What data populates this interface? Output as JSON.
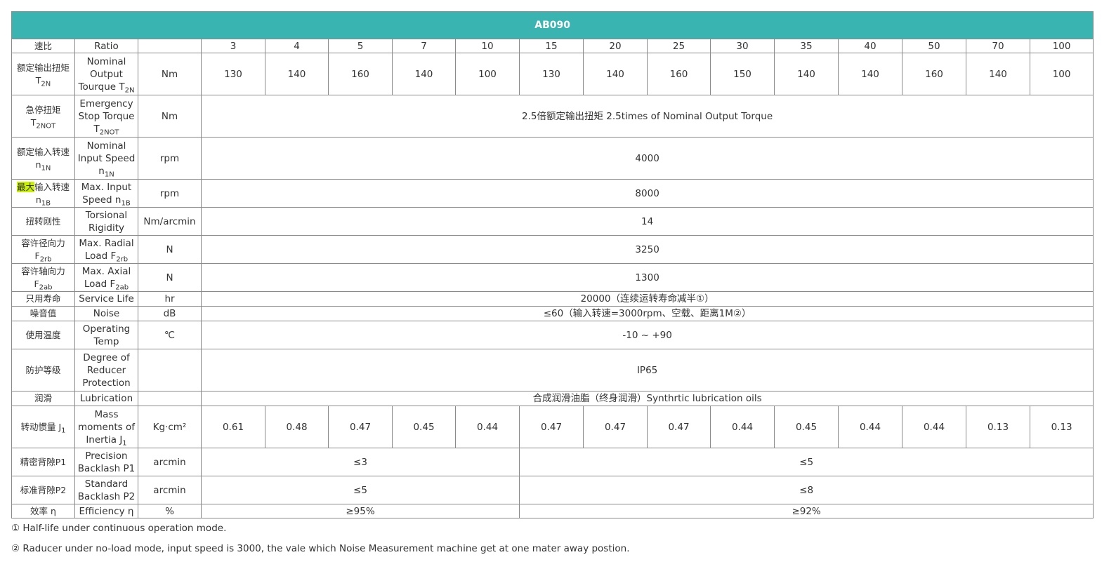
{
  "title": "AB090",
  "ratio_row": {
    "cn": "速比",
    "en": "Ratio",
    "unit": "",
    "values": [
      "3",
      "4",
      "5",
      "7",
      "10",
      "15",
      "20",
      "25",
      "30",
      "35",
      "40",
      "50",
      "70",
      "100"
    ]
  },
  "rows": {
    "nominal_torque": {
      "cn": "额定输出扭矩",
      "cn_sym": "T",
      "cn_sub": "2N",
      "en": "Nominal Output Tourque T",
      "en_sub": "2N",
      "unit": "Nm",
      "values": [
        "130",
        "140",
        "160",
        "140",
        "100",
        "130",
        "140",
        "160",
        "150",
        "140",
        "140",
        "160",
        "140",
        "100"
      ]
    },
    "emergency_torque": {
      "cn": "急停扭矩",
      "cn_sym": "T",
      "cn_sub": "2NOT",
      "en": "Emergency Stop Torque T",
      "en_sub": "2NOT",
      "unit": "Nm",
      "value": "2.5倍额定输出扭矩 2.5times of Nominal Output Torque"
    },
    "nominal_speed": {
      "cn": "额定输入转速",
      "cn_sym": "n",
      "cn_sub": "1N",
      "en": "Nominal Input Speed",
      "en_sym": "n",
      "en_sub": "1N",
      "unit": "rpm",
      "value": "4000"
    },
    "max_speed": {
      "cn_highlight": "最大",
      "cn": "输入转速",
      "cn_sym": "n",
      "cn_sub": "1B",
      "en": "Max. Input Speed n",
      "en_sub": "1B",
      "unit": "rpm",
      "value": "8000"
    },
    "rigidity": {
      "cn": "扭转刚性",
      "en": "Torsional Rigidity",
      "unit": "Nm/arcmin",
      "value": "14"
    },
    "radial_load": {
      "cn": "容许径向力",
      "cn_sym": "F",
      "cn_sub": "2rb",
      "en": "Max. Radial Load F",
      "en_sub": "2rb",
      "unit": "N",
      "value": "3250"
    },
    "axial_load": {
      "cn": "容许轴向力",
      "cn_sym": "F",
      "cn_sub": "2ab",
      "en": "Max. Axial Load F",
      "en_sub": "2ab",
      "unit": "N",
      "value": "1300"
    },
    "service_life": {
      "cn": "只用寿命",
      "en": "Service Life",
      "unit": "hr",
      "value": "20000（连续运转寿命减半①）"
    },
    "noise": {
      "cn": "噪音值",
      "en": "Noise",
      "unit": "dB",
      "value": "≤60（输入转速=3000rpm、空载、距离1M②）"
    },
    "temp": {
      "cn": "使用温度",
      "en": "Operating Temp",
      "unit": "℃",
      "value": "-10 ~ +90"
    },
    "protection": {
      "cn": "防护等级",
      "en": "Degree of Reducer Protection",
      "unit": "",
      "value": "IP65"
    },
    "lubrication": {
      "cn": "润滑",
      "en": "Lubrication",
      "unit": "",
      "value": "合成润滑油脂（终身润滑）Synthrtic lubrication oils"
    },
    "inertia": {
      "cn": "转动惯量 J",
      "cn_sub": "1",
      "en": "Mass moments of Inertia J",
      "en_sub": "1",
      "unit": "Kg·cm²",
      "values": [
        "0.61",
        "0.48",
        "0.47",
        "0.45",
        "0.44",
        "0.47",
        "0.47",
        "0.47",
        "0.44",
        "0.45",
        "0.44",
        "0.44",
        "0.13",
        "0.13"
      ]
    },
    "backlash_p1": {
      "cn": "精密背隙P1",
      "en": "Precision Backlash P1",
      "unit": "arcmin",
      "value_low": "≤3",
      "value_high": "≤5"
    },
    "backlash_p2": {
      "cn": "标准背隙P2",
      "en": "Standard Backlash P2",
      "unit": "arcmin",
      "value_low": "≤5",
      "value_high": "≤8"
    },
    "efficiency": {
      "cn": "效率 η",
      "en": "Efficiency η",
      "unit": "%",
      "value_low": "≥95%",
      "value_high": "≥92%"
    }
  },
  "notes": [
    "① Half-life under continuous operation mode.",
    "② Raducer under no-load mode, input speed is 3000, the vale which Noise Measurement machine get at one mater away postion."
  ]
}
